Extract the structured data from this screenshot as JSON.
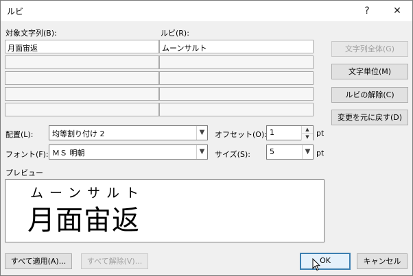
{
  "window": {
    "title": "ルビ",
    "help": "?",
    "close": "✕"
  },
  "labels": {
    "base_text": "対象文字列(B):",
    "ruby": "ルビ(R):",
    "alignment": "配置(L):",
    "offset": "オフセット(O):",
    "font": "フォント(F):",
    "size": "サイズ(S):",
    "pt1": "pt",
    "pt2": "pt",
    "preview": "プレビュー"
  },
  "rows": [
    {
      "base": "月面宙返",
      "ruby": "ムーンサルト"
    },
    {
      "base": "",
      "ruby": ""
    },
    {
      "base": "",
      "ruby": ""
    },
    {
      "base": "",
      "ruby": ""
    },
    {
      "base": "",
      "ruby": ""
    }
  ],
  "side_buttons": {
    "whole": "文字列全体(G)",
    "per_char": "文字単位(M)",
    "remove": "ルビの解除(C)",
    "undo": "変更を元に戻す(D)"
  },
  "alignment_value": "均等割り付け 2",
  "offset_value": "1",
  "font_value": "ＭＳ 明朝",
  "size_value": "5",
  "preview": {
    "ruby": "ムーンサルト",
    "base": "月面宙返"
  },
  "bottom_buttons": {
    "apply_all": "すべて適用(A)...",
    "remove_all": "すべて解除(V)...",
    "ok": "OK",
    "cancel": "キャンセル"
  },
  "colors": {
    "default_border": "#3c7fb1",
    "disabled_text": "#a0a0a0"
  }
}
